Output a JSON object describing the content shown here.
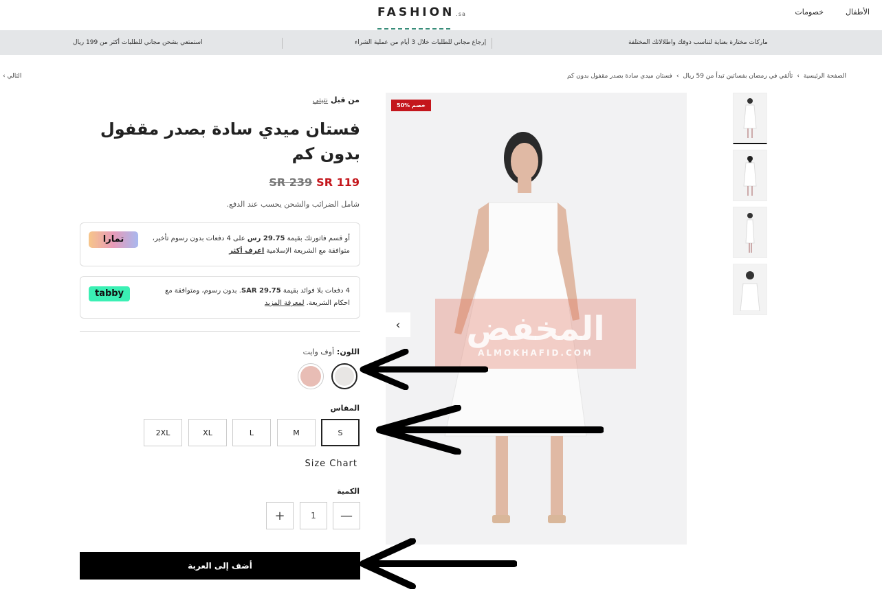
{
  "header": {
    "logo": "FASHION",
    "logo_suffix": ".sa",
    "nav": [
      "الأطفال",
      "خصومات"
    ]
  },
  "promo": {
    "items": [
      "ماركات مختارة بعناية لتناسب ذوقك واطلالاتك المختلفة",
      "إرجاع مجاني للطلبات خلال 3 أيام من عملية الشراء",
      "استمتعي بشحن مجاني للطلبات أكثر من 199 ريال"
    ]
  },
  "breadcrumb": {
    "items": [
      "الصفحة الرئيسية",
      "تألقي في رمضان بفساتين تبدأ من 59 ريال",
      "فستان ميدي سادة بصدر مقفول بدون كم"
    ],
    "separator": "›",
    "next": "التالي"
  },
  "gallery": {
    "badge": "50% خصم",
    "prev_icon": "chevron-left-icon",
    "watermark_text": "المخفض",
    "watermark_domain": "ALMOKHAFID.COM"
  },
  "product": {
    "by_label": "من قبل",
    "brand": "نتيتي",
    "title": "فستان ميدي سادة بصدر مقفول بدون كم",
    "price_now": "119 SR",
    "price_was": "239 SR",
    "tax_note": "شامل الضرائب والشحن يحسب عند الدفع."
  },
  "tamara": {
    "logo": "تمارا",
    "text_a": "أو قسم فاتورتك بقيمة ",
    "amount": "29.75 رس",
    "text_b": " على 4 دفعات بدون رسوم تأخير، متوافقة مع الشريعة الإسلامية ",
    "link": "اعرف أكثر"
  },
  "tabby": {
    "logo": "tabby",
    "text_a": "4 دفعات بلا فوائد بقيمة ",
    "amount": "SAR 29.75",
    "text_b": ". بدون رسوم، ومتوافقة مع احكام الشريعة. ",
    "link": "لمعرفة المزيد"
  },
  "color": {
    "label": "اللون:",
    "selected": "أوف وايت",
    "swatches": [
      {
        "name": "off-white",
        "color": "#e8e6e4"
      },
      {
        "name": "pink",
        "color": "#e8bdb5"
      }
    ]
  },
  "size": {
    "label": "المقاس",
    "options": [
      "S",
      "M",
      "L",
      "XL",
      "2XL"
    ],
    "selected": "S",
    "chart_link": "Size Chart"
  },
  "quantity": {
    "label": "الكمية",
    "value": "1",
    "minus_icon": "minus-icon",
    "plus_icon": "plus-icon"
  },
  "cart": {
    "add_label": "أضف إلى العربة"
  }
}
